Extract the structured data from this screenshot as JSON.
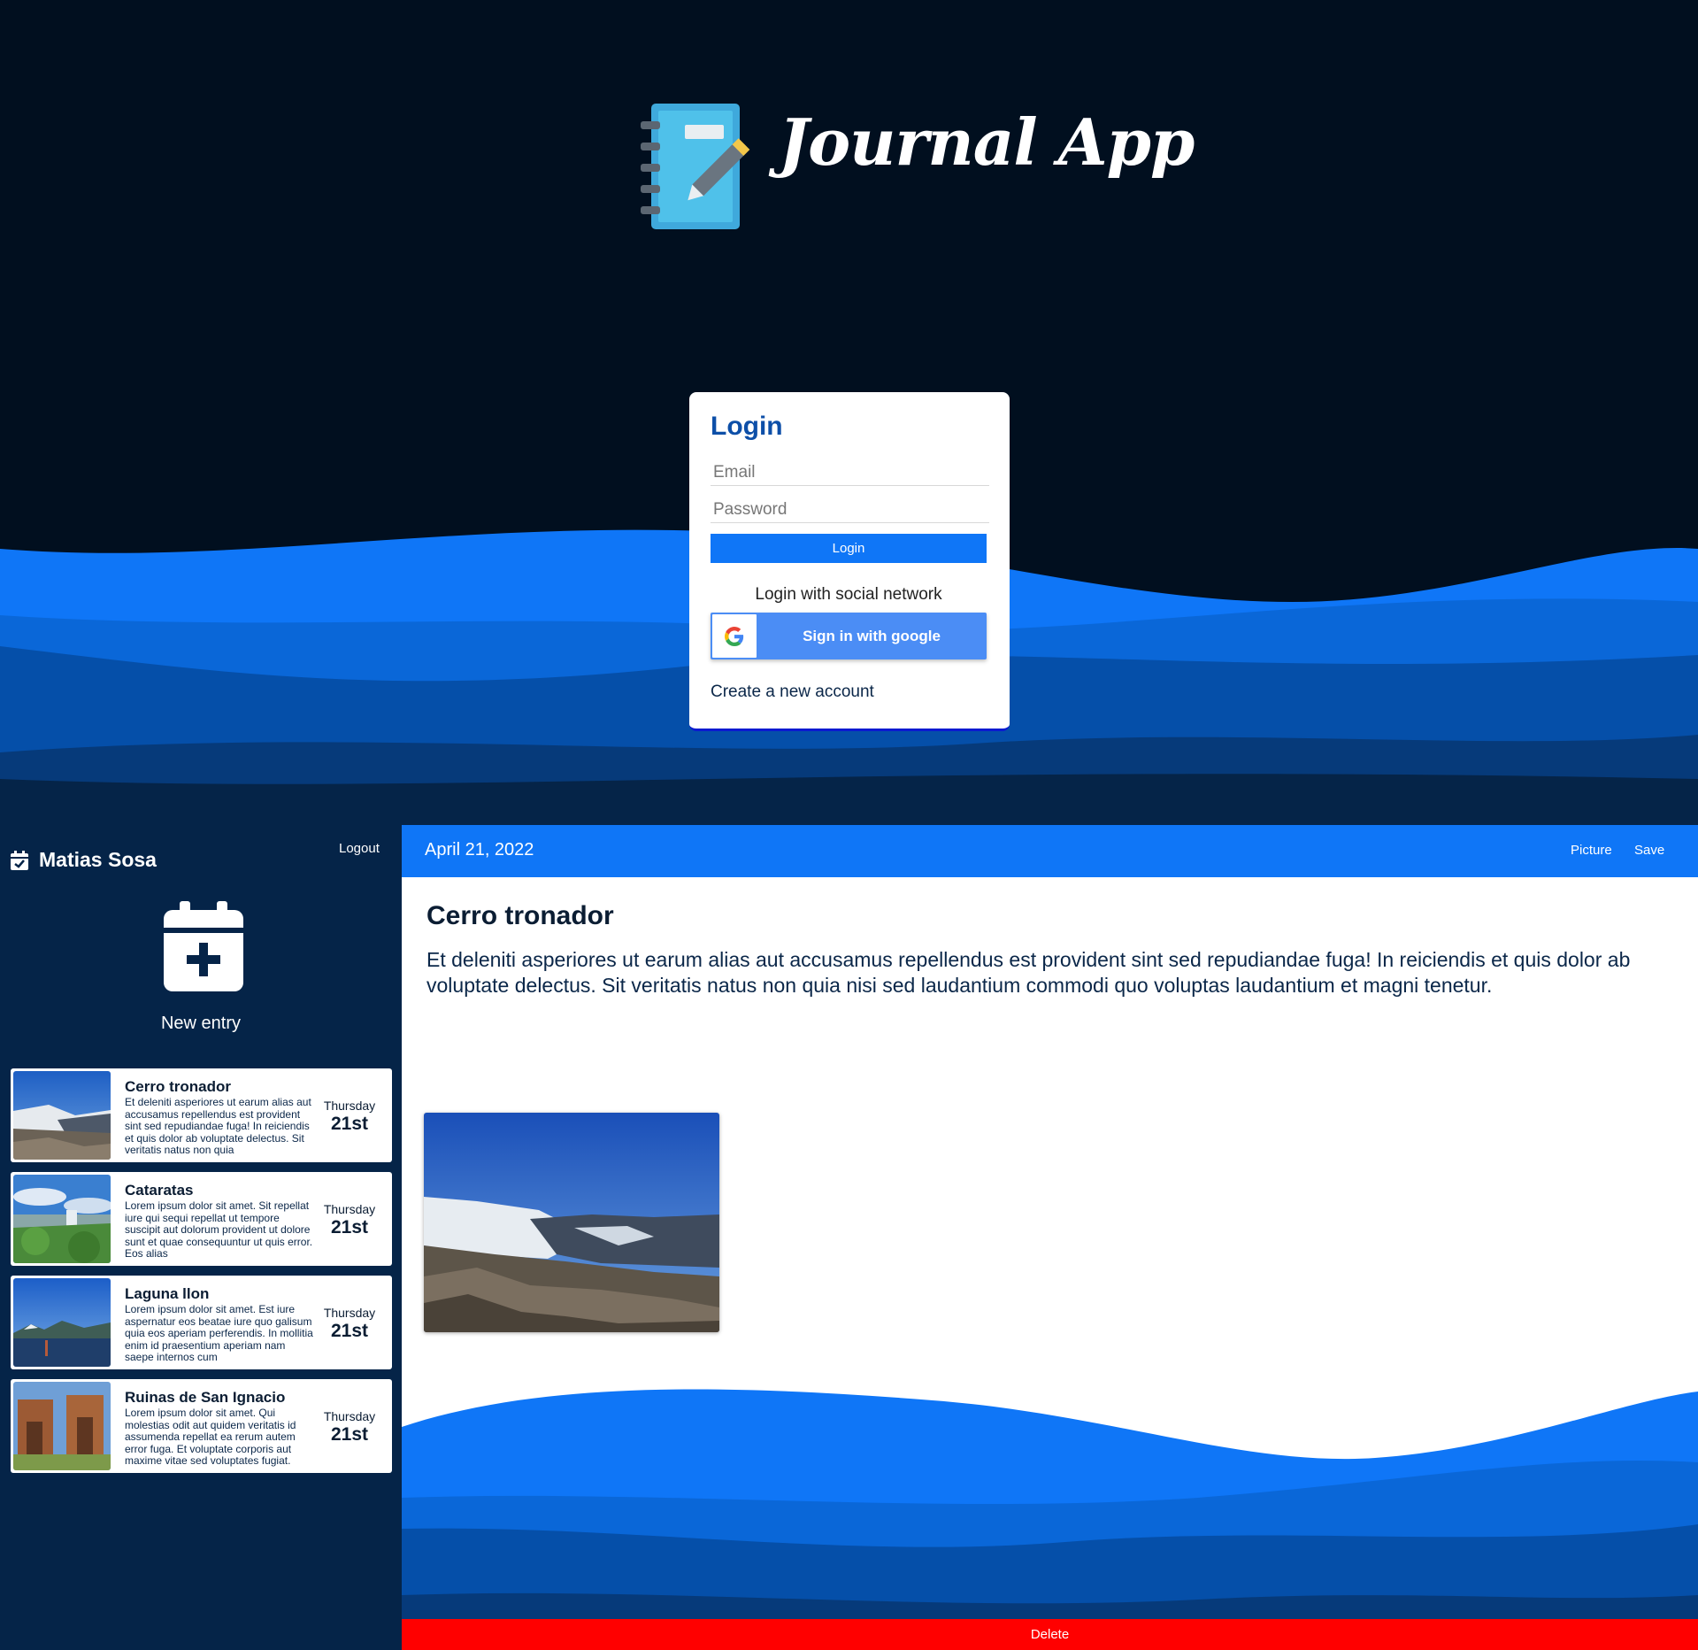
{
  "login": {
    "logo_text": "Journal App",
    "title": "Login",
    "email_placeholder": "Email",
    "password_placeholder": "Password",
    "login_button": "Login",
    "social_label": "Login with social network",
    "google_button": "Sign in with google",
    "create_account": "Create a new account"
  },
  "sidebar": {
    "user_name": "Matias Sosa",
    "logout": "Logout",
    "new_entry": "New entry",
    "entries": [
      {
        "title": "Cerro tronador",
        "text": "Et deleniti asperiores ut earum alias aut accusamus repellendus est provident sint sed repudiandae fuga! In reiciendis et quis dolor ab voluptate delectus. Sit veritatis natus non quia",
        "day": "Thursday",
        "date": "21st"
      },
      {
        "title": "Cataratas",
        "text": "Lorem ipsum dolor sit amet. Sit repellat iure qui sequi repellat ut tempore suscipit aut dolorum provident ut dolore sunt et quae consequuntur ut quis error. Eos alias",
        "day": "Thursday",
        "date": "21st"
      },
      {
        "title": "Laguna llon",
        "text": "Lorem ipsum dolor sit amet. Est iure aspernatur eos beatae iure quo galisum quia eos aperiam perferendis. In mollitia enim id praesentium aperiam nam saepe internos cum",
        "day": "Thursday",
        "date": "21st"
      },
      {
        "title": "Ruinas de San Ignacio",
        "text": "Lorem ipsum dolor sit amet. Qui molestias odit aut quidem veritatis id assumenda repellat ea rerum autem error fuga. Et voluptate corporis aut maxime vitae sed voluptates fugiat.",
        "day": "Thursday",
        "date": "21st"
      }
    ]
  },
  "note": {
    "date": "April 21, 2022",
    "picture_button": "Picture",
    "save_button": "Save",
    "title": "Cerro tronador",
    "body": "Et deleniti asperiores ut earum alias aut accusamus repellendus est provident sint sed repudiandae fuga! In reiciendis et quis dolor ab voluptate delectus. Sit veritatis natus non quia nisi sed laudantium commodi quo voluptas laudantium et magni tenetur.",
    "delete_button": "Delete"
  },
  "colors": {
    "background_dark": "#010f1f",
    "sidebar": "#052448",
    "accent_blue": "#0f76f7",
    "title_blue": "#0d4fa8",
    "delete_red": "#ff0000"
  },
  "icons": [
    "journal-logo-icon",
    "google-icon",
    "calendar-check-icon",
    "calendar-plus-icon"
  ]
}
